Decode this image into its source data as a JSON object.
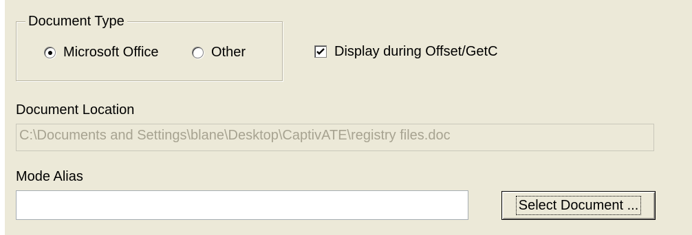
{
  "document_type": {
    "title": "Document Type",
    "options": [
      {
        "label": "Microsoft Office",
        "selected": true
      },
      {
        "label": "Other",
        "selected": false
      }
    ]
  },
  "display_checkbox": {
    "label": "Display during Offset/GetC",
    "checked": true
  },
  "document_location": {
    "label": "Document Location",
    "value": "C:\\Documents and Settings\\blane\\Desktop\\CaptivATE\\registry files.doc",
    "enabled": false
  },
  "mode_alias": {
    "label": "Mode Alias",
    "value": ""
  },
  "select_document_button": {
    "label": "Select Document ..."
  },
  "colors": {
    "dialog_background": "#ece9d8",
    "disabled_text": "#a7a391"
  }
}
